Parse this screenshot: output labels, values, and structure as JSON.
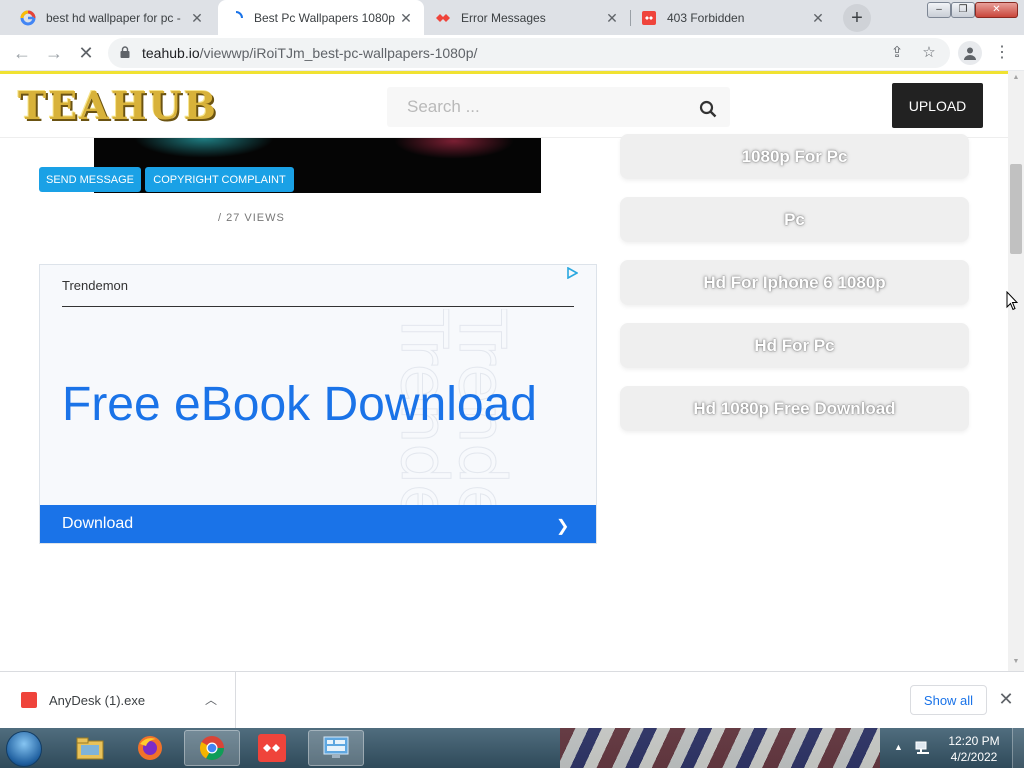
{
  "browser": {
    "tabs": [
      {
        "title": "best hd wallpaper for pc -",
        "favicon": "google-icon",
        "active": false
      },
      {
        "title": "Best Pc Wallpapers 1080p",
        "favicon": "loading-spinner-icon",
        "active": true
      },
      {
        "title": "Error Messages",
        "favicon": "anydesk-icon",
        "active": false
      },
      {
        "title": "403 Forbidden",
        "favicon": "anydesk-icon",
        "active": false
      }
    ],
    "new_tab_symbol": "+",
    "url_host": "teahub.io",
    "url_path": "/viewwp/iRoiTJm_best-pc-wallpapers-1080p/"
  },
  "site": {
    "logo_text": "TEAHUB",
    "search_placeholder": "Search ...",
    "upload_label": "UPLOAD",
    "send_message_label": "SEND MESSAGE",
    "copyright_label": "COPYRIGHT COMPLAINT",
    "views_text": "/ 27 VIEWS"
  },
  "ad": {
    "brand": "Trendemon",
    "headline": "Free eBook Download",
    "cta_label": "Download",
    "accent_color": "#1a73e8"
  },
  "related_tags": [
    "1080p For Pc",
    "Pc",
    "Hd For Iphone 6 1080p",
    "Hd For Pc",
    "Hd 1080p Free Download"
  ],
  "downloads": {
    "file_name": "AnyDesk (1).exe",
    "show_all_label": "Show all"
  },
  "taskbar": {
    "apps": [
      "file-explorer-icon",
      "firefox-icon",
      "chrome-icon",
      "anydesk-icon",
      "control-panel-icon"
    ],
    "time": "12:20 PM",
    "date": "4/2/2022"
  }
}
